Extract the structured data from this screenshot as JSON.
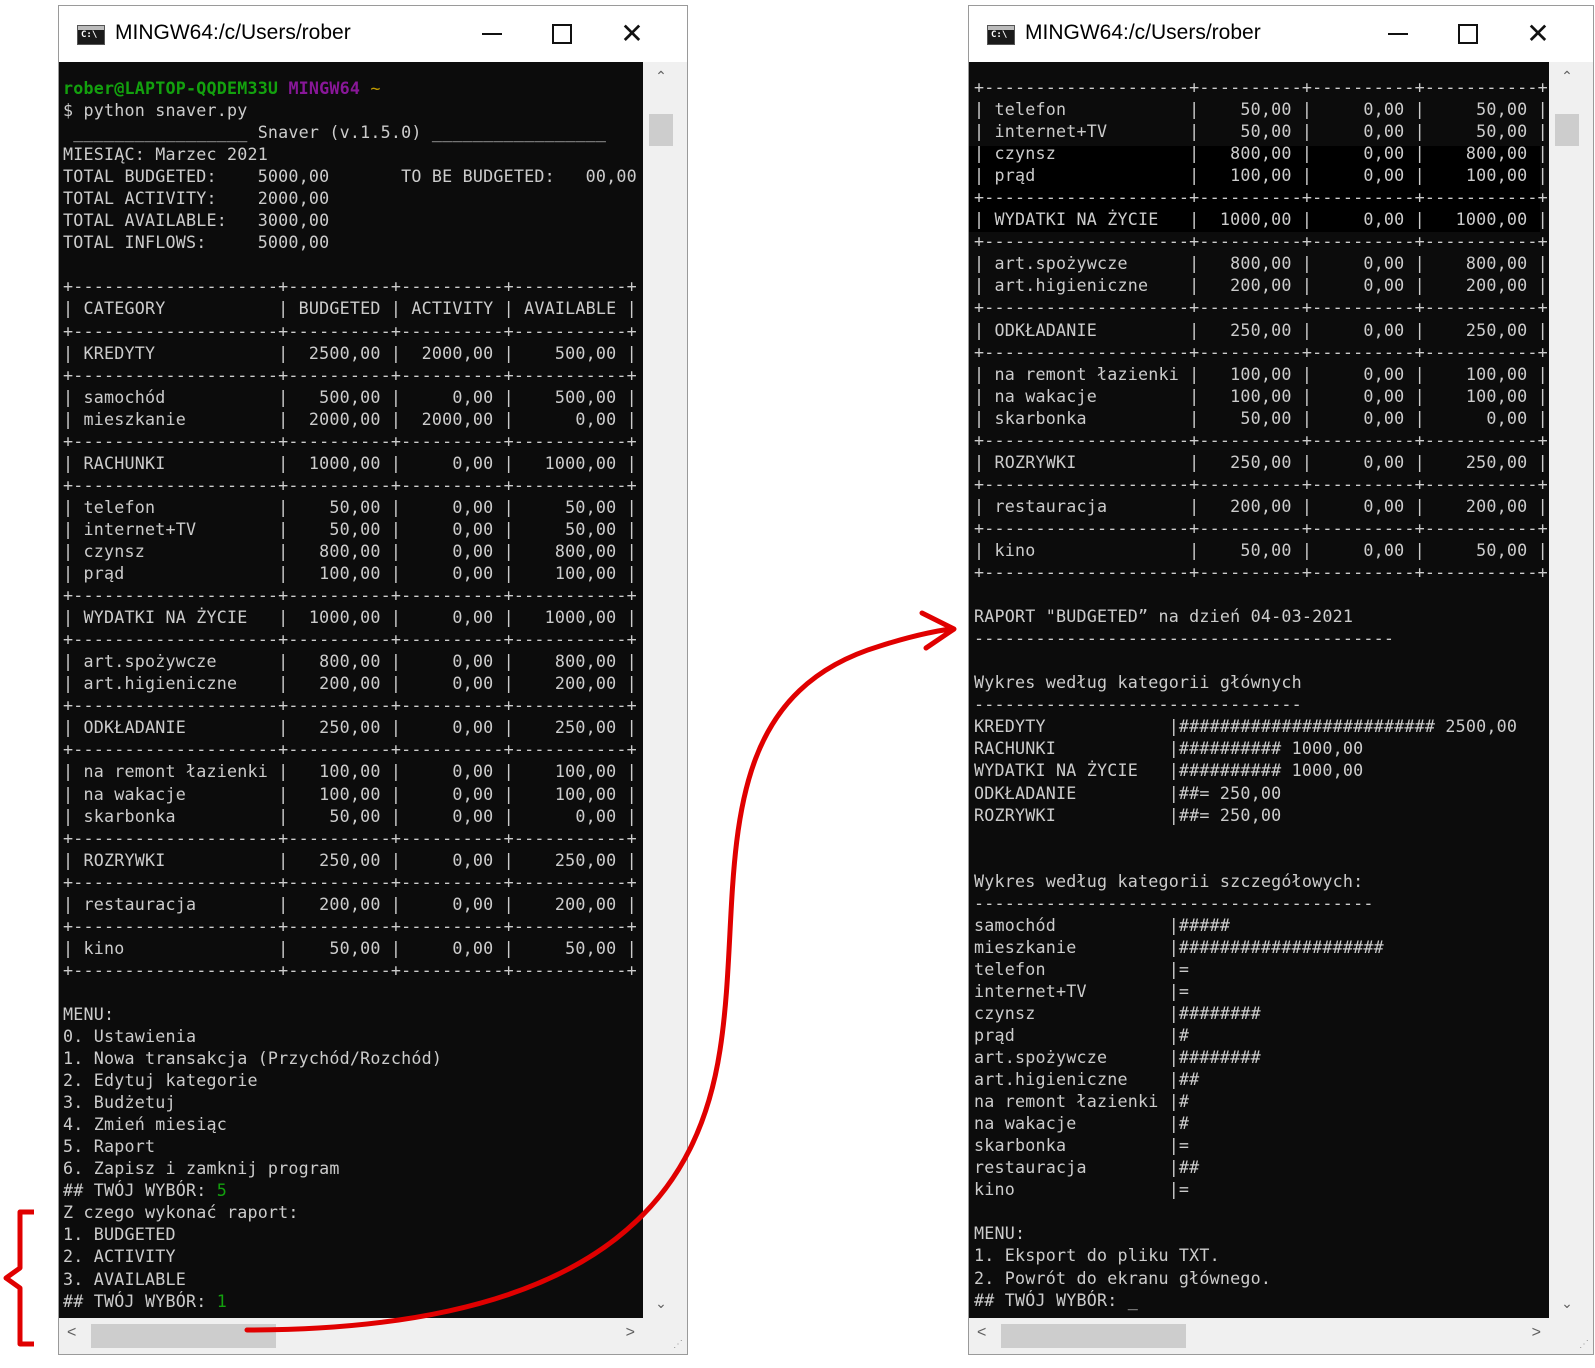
{
  "window_left": {
    "title": "MINGW64:/c/Users/rober",
    "prompt_user": "rober@LAPTOP-QQDEM33U",
    "prompt_env": "MINGW64",
    "prompt_dir": "~",
    "command": "$ python snaver.py",
    "body_text": " _________________ Snaver (v.1.5.0) _________________\nMIESIĄC: Marzec 2021\nTOTAL BUDGETED:    5000,00       TO BE BUDGETED:   00,00\nTOTAL ACTIVITY:    2000,00\nTOTAL AVAILABLE:   3000,00\nTOTAL INFLOWS:     5000,00\n\n+--------------------+----------+----------+-----------+\n| CATEGORY           | BUDGETED | ACTIVITY | AVAILABLE |\n+--------------------+----------+----------+-----------+\n| KREDYTY            |  2500,00 |  2000,00 |    500,00 |\n+--------------------+----------+----------+-----------+\n| samochód           |   500,00 |     0,00 |    500,00 |\n| mieszkanie         |  2000,00 |  2000,00 |      0,00 |\n+--------------------+----------+----------+-----------+\n| RACHUNKI           |  1000,00 |     0,00 |   1000,00 |\n+--------------------+----------+----------+-----------+\n| telefon            |    50,00 |     0,00 |     50,00 |\n| internet+TV        |    50,00 |     0,00 |     50,00 |\n| czynsz             |   800,00 |     0,00 |    800,00 |\n| prąd               |   100,00 |     0,00 |    100,00 |\n+--------------------+----------+----------+-----------+\n| WYDATKI NA ŻYCIE   |  1000,00 |     0,00 |   1000,00 |\n+--------------------+----------+----------+-----------+\n| art.spożywcze      |   800,00 |     0,00 |    800,00 |\n| art.higieniczne    |   200,00 |     0,00 |    200,00 |\n+--------------------+----------+----------+-----------+\n| ODKŁADANIE         |   250,00 |     0,00 |    250,00 |\n+--------------------+----------+----------+-----------+\n| na remont łazienki |   100,00 |     0,00 |    100,00 |\n| na wakacje         |   100,00 |     0,00 |    100,00 |\n| skarbonka          |    50,00 |     0,00 |      0,00 |\n+--------------------+----------+----------+-----------+\n| ROZRYWKI           |   250,00 |     0,00 |    250,00 |\n+--------------------+----------+----------+-----------+\n| restauracja        |   200,00 |     0,00 |    200,00 |\n+--------------------+----------+----------+-----------+\n| kino               |    50,00 |     0,00 |     50,00 |\n+--------------------+----------+----------+-----------+\n\nMENU:\n0. Ustawienia\n1. Nowa transakcja (Przychód/Rozchód)\n2. Edytuj kategorie\n3. Budżetuj\n4. Zmień miesiąc\n5. Raport\n6. Zapisz i zamknij program",
    "choice_label_1": "## TWÓJ WYBÓR: ",
    "choice_value_1": "5",
    "report_prompt": "Z czego wykonać raport:\n1. BUDGETED\n2. ACTIVITY\n3. AVAILABLE",
    "choice_label_2": "## TWÓJ WYBÓR: ",
    "choice_value_2": "1"
  },
  "window_right": {
    "title": "MINGW64:/c/Users/rober",
    "body_text": "+--------------------+----------+----------+-----------+\n| telefon            |    50,00 |     0,00 |     50,00 |\n| internet+TV        |    50,00 |     0,00 |     50,00 |\n| czynsz             |   800,00 |     0,00 |    800,00 |\n| prąd               |   100,00 |     0,00 |    100,00 |\n+--------------------+----------+----------+-----------+\n| WYDATKI NA ŻYCIE   |  1000,00 |     0,00 |   1000,00 |\n+--------------------+----------+----------+-----------+\n| art.spożywcze      |   800,00 |     0,00 |    800,00 |\n| art.higieniczne    |   200,00 |     0,00 |    200,00 |\n+--------------------+----------+----------+-----------+\n| ODKŁADANIE         |   250,00 |     0,00 |    250,00 |\n+--------------------+----------+----------+-----------+\n| na remont łazienki |   100,00 |     0,00 |    100,00 |\n| na wakacje         |   100,00 |     0,00 |    100,00 |\n| skarbonka          |    50,00 |     0,00 |      0,00 |\n+--------------------+----------+----------+-----------+\n| ROZRYWKI           |   250,00 |     0,00 |    250,00 |\n+--------------------+----------+----------+-----------+\n| restauracja        |   200,00 |     0,00 |    200,00 |\n+--------------------+----------+----------+-----------+\n| kino               |    50,00 |     0,00 |     50,00 |\n+--------------------+----------+----------+-----------+\n\nRAPORT \"BUDGETED” na dzień 04-03-2021\n-----------------------------------------\n\nWykres według kategorii głównych\n--------------------------------\nKREDYTY            |######################### 2500,00\nRACHUNKI           |########## 1000,00\nWYDATKI NA ŻYCIE   |########## 1000,00\nODKŁADANIE         |##= 250,00\nROZRYWKI           |##= 250,00\n\n\nWykres według kategorii szczegółowych:\n---------------------------------------\nsamochód           |#####\nmieszkanie         |####################\ntelefon            |=\ninternet+TV        |=\nczynsz             |########\nprąd               |#\nart.spożywcze      |########\nart.higieniczne    |##\nna remont łazienki |#\nna wakacje         |#\nskarbonka          |=\nrestauracja        |##\nkino               |=\n\nMENU:\n1. Eksport do pliku TXT.\n2. Powrót do ekranu głównego.\n## TWÓJ WYBÓR: _"
  },
  "colors": {
    "annotation": "#e00000",
    "terminal_bg": "#0c0c0c",
    "terminal_text": "#cccccc",
    "prompt_user": "#13a10e",
    "prompt_env": "#881798",
    "prompt_dir": "#c19c00"
  },
  "icons": [
    "console-app-icon",
    "minimize-icon",
    "maximize-icon",
    "close-icon",
    "scroll-up-arrow-icon",
    "scroll-down-arrow-icon",
    "scroll-left-arrow-icon",
    "scroll-right-arrow-icon"
  ]
}
